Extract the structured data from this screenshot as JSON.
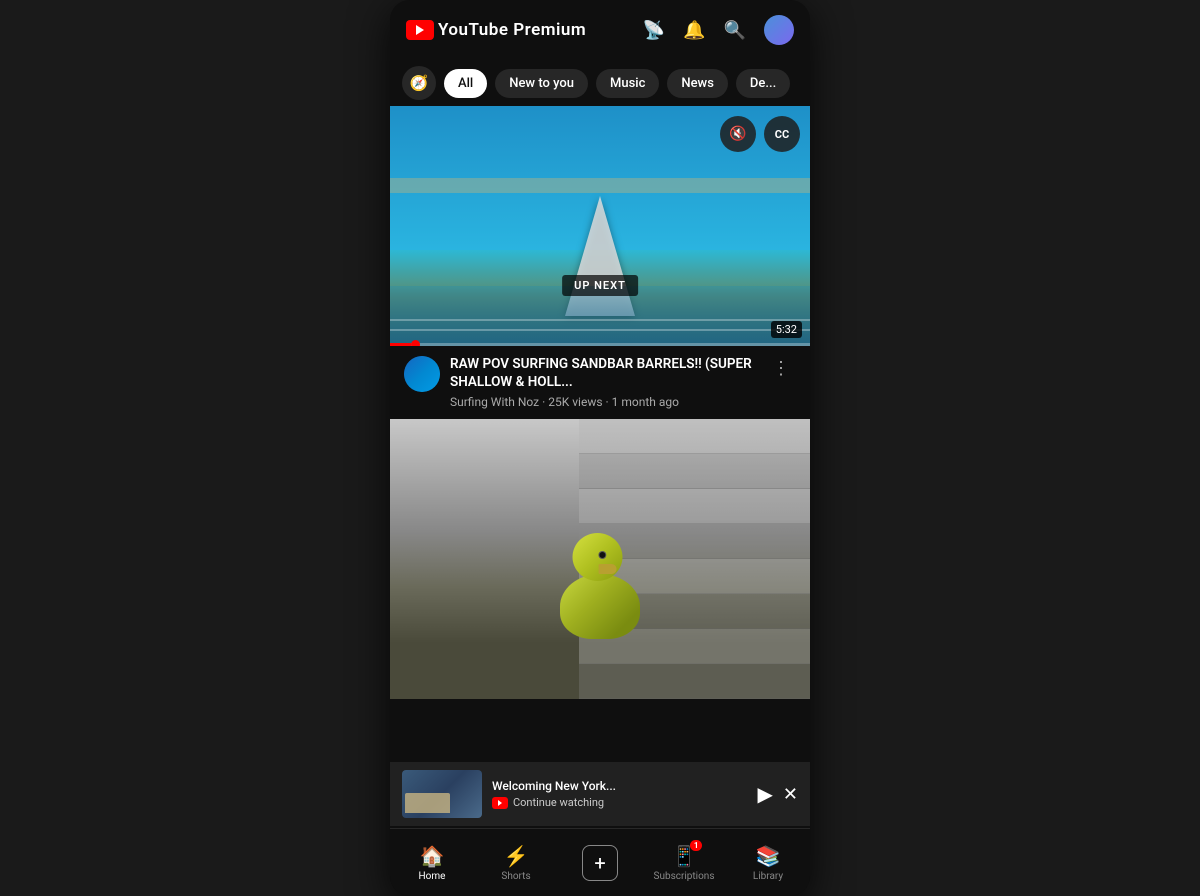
{
  "app": {
    "title": "YouTube Premium"
  },
  "header": {
    "logo_label": "Premium",
    "cast_icon": "📡",
    "bell_icon": "🔔",
    "search_icon": "🔍"
  },
  "tabs": [
    {
      "id": "explore",
      "label": "🧭",
      "type": "icon"
    },
    {
      "id": "all",
      "label": "All",
      "active": true
    },
    {
      "id": "new-to-you",
      "label": "New to you"
    },
    {
      "id": "music",
      "label": "Music"
    },
    {
      "id": "news",
      "label": "News"
    },
    {
      "id": "deals",
      "label": "De..."
    }
  ],
  "video1": {
    "duration": "5:32",
    "up_next": "UP NEXT",
    "title": "RAW POV SURFING SANDBAR BARRELS!! (SUPER SHALLOW & HOLL...",
    "channel": "Surfing With Noz",
    "views": "25K views",
    "time_ago": "1 month ago",
    "meta": "Surfing With Noz · 25K views · 1 month ago"
  },
  "mini_player": {
    "title": "Welcoming New York...",
    "continue_label": "Continue watching",
    "play_icon": "▶",
    "close_icon": "✕"
  },
  "bottom_nav": [
    {
      "id": "home",
      "label": "Home",
      "icon": "🏠",
      "active": true
    },
    {
      "id": "shorts",
      "label": "Shorts",
      "icon": "⚡",
      "active": false
    },
    {
      "id": "add",
      "label": "",
      "icon": "+",
      "active": false
    },
    {
      "id": "subscriptions",
      "label": "Subscriptions",
      "icon": "📱",
      "active": false,
      "badge": "1"
    },
    {
      "id": "library",
      "label": "Library",
      "icon": "📚",
      "active": false
    }
  ],
  "icons": {
    "mute": "🔇",
    "captions": "CC"
  }
}
